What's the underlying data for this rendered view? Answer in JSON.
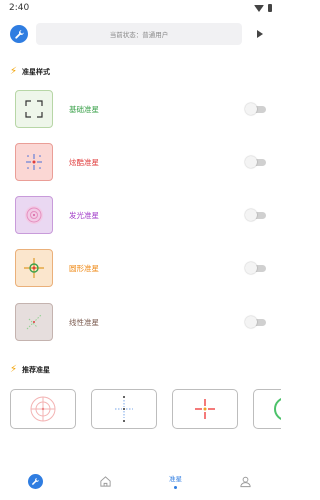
{
  "status_bar": {
    "time": "2:40"
  },
  "top_bar": {
    "status_text": "当前状态：普通用户"
  },
  "sections": {
    "styles_title": "准星样式",
    "recommend_title": "推荐准星"
  },
  "styles": [
    {
      "label": "基础准星",
      "color": "#3aa14a",
      "bg": "#eef6ea",
      "border": "#b7d6a6",
      "icon": "basic-crosshair-icon",
      "enabled": false
    },
    {
      "label": "炫酷准星",
      "color": "#e03c3c",
      "bg": "#fbd7d4",
      "border": "#ea9e97",
      "icon": "cool-crosshair-icon",
      "enabled": false
    },
    {
      "label": "发光准星",
      "color": "#a23cc9",
      "bg": "#ead8f2",
      "border": "#c89bda",
      "icon": "glow-crosshair-icon",
      "enabled": false
    },
    {
      "label": "圆形准星",
      "color": "#ef8a17",
      "bg": "#fbe6cd",
      "border": "#eab07a",
      "icon": "circle-crosshair-icon",
      "enabled": false
    },
    {
      "label": "线性准星",
      "color": "#7a5a4e",
      "bg": "#e6dedd",
      "border": "#c4b3af",
      "icon": "linear-crosshair-icon",
      "enabled": false
    }
  ],
  "bottom_nav": [
    {
      "label": "",
      "icon": "tool-icon"
    },
    {
      "label": "",
      "icon": "home-icon"
    },
    {
      "label": "准星",
      "icon": "crosshair-icon",
      "active": true
    },
    {
      "label": "",
      "icon": "user-icon"
    }
  ]
}
